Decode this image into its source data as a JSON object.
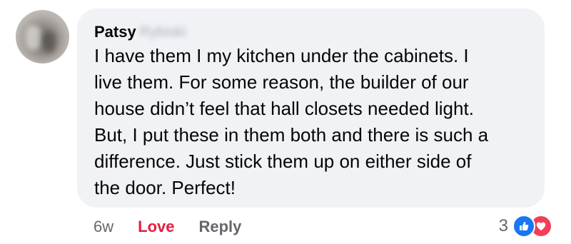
{
  "comment": {
    "author_first": "Patsy",
    "author_last_blurred": "Rybiski",
    "text": "I have them I my kitchen under the cabinets.  I\nlive them.  For some reason, the builder of our\nhouse didn’t feel that hall closets needed light.\nBut, I put these in them both and there is such a\ndifference.  Just stick them up on either side of\nthe door. Perfect!",
    "avatar_icon": "profile-photo-blurred"
  },
  "actions": {
    "time_ago": "6w",
    "love_label": "Love",
    "reply_label": "Reply"
  },
  "reactions": {
    "count": "3",
    "icons": [
      "like-icon",
      "heart-icon"
    ],
    "like_color": "#1877f2",
    "heart_color": "#f33e58"
  },
  "colors": {
    "bubble": "#f0f2f5",
    "love_active": "#e41e3f",
    "secondary_text": "#65676b"
  }
}
